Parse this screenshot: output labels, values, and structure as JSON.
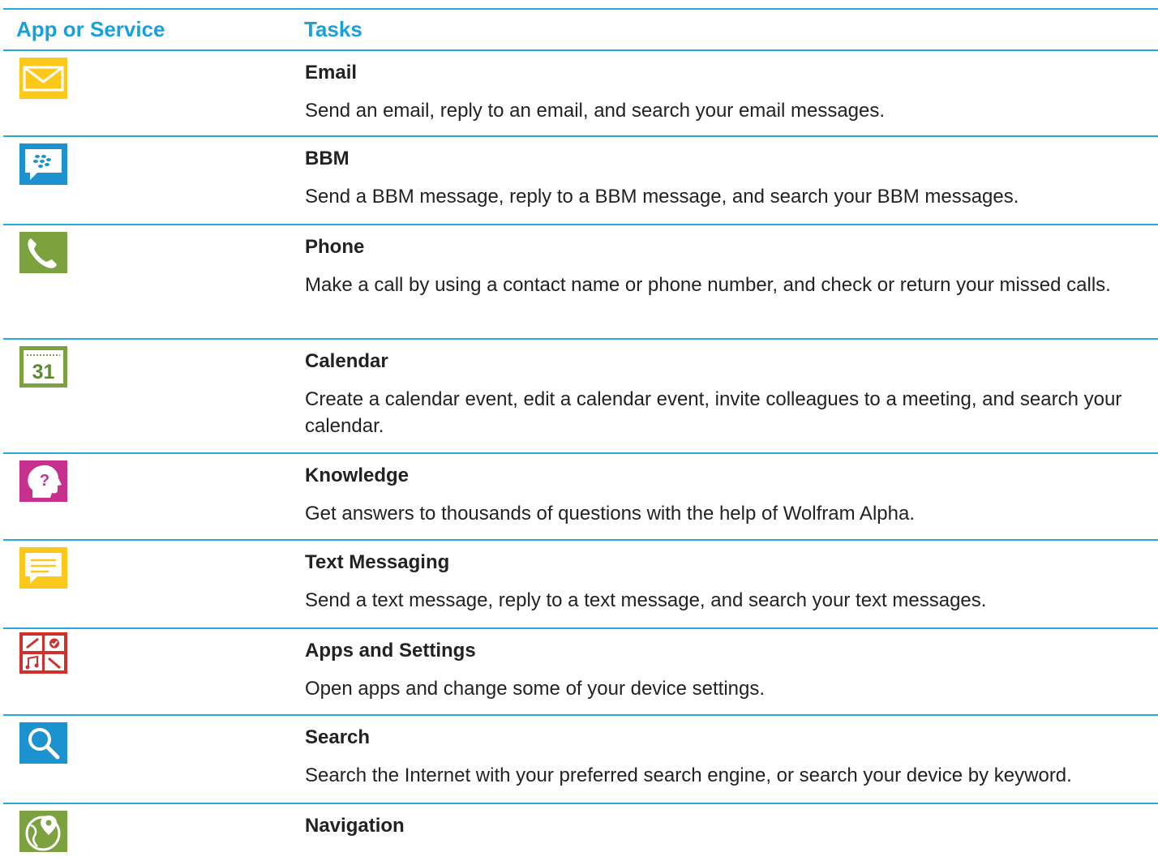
{
  "header": {
    "col_app": "App or Service",
    "col_tasks": "Tasks"
  },
  "rows": [
    {
      "icon": "email-icon",
      "title": "Email",
      "desc": "Send an email, reply to an email, and search your email messages."
    },
    {
      "icon": "bbm-icon",
      "title": "BBM",
      "desc": "Send a BBM message, reply to a BBM message, and search your BBM messages."
    },
    {
      "icon": "phone-icon",
      "title": "Phone",
      "desc": "Make a call by using a contact name or phone number, and check or return your missed calls."
    },
    {
      "icon": "calendar-icon",
      "title": "Calendar",
      "desc": "Create a calendar event, edit a calendar event, invite colleagues to a meeting, and search your calendar.",
      "icon_text": "31"
    },
    {
      "icon": "knowledge-icon",
      "title": "Knowledge",
      "desc": "Get answers to thousands of questions with the help of Wolfram Alpha."
    },
    {
      "icon": "text-messaging-icon",
      "title": "Text Messaging",
      "desc": "Send a text message, reply to a text message, and search your text messages."
    },
    {
      "icon": "apps-settings-icon",
      "title": "Apps and Settings",
      "desc": "Open apps and change some of your device settings."
    },
    {
      "icon": "search-icon",
      "title": "Search",
      "desc": "Search the Internet with your preferred search engine, or search your device by keyword."
    },
    {
      "icon": "navigation-icon",
      "title": "Navigation",
      "desc": ""
    }
  ],
  "colors": {
    "rule": "#28a9dc",
    "header_text": "#1aa0d8"
  }
}
